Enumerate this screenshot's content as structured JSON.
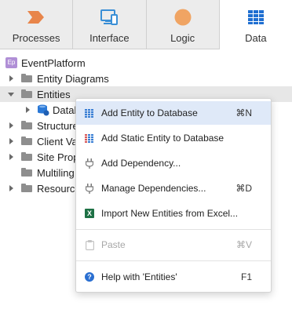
{
  "tabs": [
    {
      "label": "Processes",
      "icon": "processes-icon",
      "color": "#e8854a"
    },
    {
      "label": "Interface",
      "icon": "interface-icon",
      "color": "#3a8fd6"
    },
    {
      "label": "Logic",
      "icon": "logic-icon",
      "color": "#f0a463"
    },
    {
      "label": "Data",
      "icon": "data-icon",
      "color": "#1f6fd1",
      "active": true
    }
  ],
  "tree": {
    "root": {
      "label": "EventPlatform",
      "badge": "Ep"
    },
    "items": [
      {
        "label": "Entity Diagrams",
        "expanded": false
      },
      {
        "label": "Entities",
        "expanded": true,
        "selected": true
      },
      {
        "label": "Datab",
        "child": true
      },
      {
        "label": "Structure",
        "expanded": false
      },
      {
        "label": "Client Va",
        "expanded": false
      },
      {
        "label": "Site Prop",
        "expanded": false
      },
      {
        "label": "Multiling",
        "expanded": false
      },
      {
        "label": "Resource",
        "expanded": false
      }
    ]
  },
  "menu": {
    "items": [
      {
        "label": "Add Entity to Database",
        "shortcut": "⌘N",
        "icon": "entity-grid-icon",
        "highlighted": true
      },
      {
        "label": "Add Static Entity to Database",
        "shortcut": "",
        "icon": "static-entity-icon"
      },
      {
        "label": "Add Dependency...",
        "shortcut": "",
        "icon": "plug-icon"
      },
      {
        "label": "Manage Dependencies...",
        "shortcut": "⌘D",
        "icon": "plug-icon"
      },
      {
        "label": "Import New Entities from Excel...",
        "shortcut": "",
        "icon": "excel-icon"
      },
      {
        "label": "Paste",
        "shortcut": "⌘V",
        "icon": "clipboard-icon",
        "disabled": true
      },
      {
        "label": "Help with 'Entities'",
        "shortcut": "F1",
        "icon": "help-icon"
      }
    ]
  },
  "colors": {
    "accent": "#1f6fd1",
    "menu_highlight": "#dfe9f8",
    "folder": "#8e8e8e",
    "excel": "#1e7145",
    "badge": "#b08fd6"
  }
}
